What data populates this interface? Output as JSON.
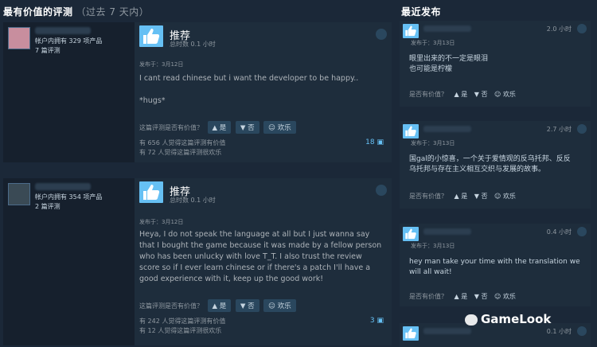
{
  "left_section": {
    "title": "最有价值的评测",
    "subtitle": "（过去 7 天内）"
  },
  "right_section": {
    "title": "最近发布"
  },
  "reviews": [
    {
      "owned": "帐户内拥有 329 项产品",
      "reviews_count": "7 篇评测",
      "verdict": "推荐",
      "hours": "总时数 0.1 小时",
      "posted": "发布于：3月12日",
      "text_lines": [
        "I cant read chinese but i want the developer to be happy..",
        "",
        "*hugs*"
      ],
      "helpful_q": "这篇评测是否有价值？",
      "yes": "是",
      "no": "否",
      "funny": "欢乐",
      "helpful_line": "有 656 人觉得这篇评测有价值",
      "funny_line": "有 72 人觉得这篇评测很欢乐",
      "comments": "18"
    },
    {
      "owned": "帐户内拥有 354 项产品",
      "reviews_count": "2 篇评测",
      "verdict": "推荐",
      "hours": "总时数 0.1 小时",
      "posted": "发布于：3月12日",
      "text_lines": [
        "Heya, I do not speak the language at all but I just wanna say",
        "that I bought the game because it was made by a fellow person",
        "who has been unlucky with love T_T. I also trust the review",
        "score so if I ever learn chinese or if there's a patch I'll have a",
        "good experience with it, keep up the good work!"
      ],
      "helpful_q": "这篇评测是否有价值？",
      "yes": "是",
      "no": "否",
      "funny": "欢乐",
      "helpful_line": "有 242 人觉得这篇评测有价值",
      "funny_line": "有 12 人觉得这篇评测很欢乐",
      "comments": "3"
    }
  ],
  "recent": [
    {
      "hours": "2.0 小时",
      "posted": "发布于：3月13日",
      "text_lines": [
        "眼里出来的不一定是眼泪",
        "也可能是柠檬"
      ],
      "helpful_q": "是否有价值？",
      "yes": "是",
      "no": "否",
      "funny": "欢乐"
    },
    {
      "hours": "2.7 小时",
      "posted": "发布于：3月13日",
      "text_lines": [
        "国gal的小惊喜，一个关于爱情观的反乌托邦、反反",
        "乌托邦与存在主义相互交织与发展的故事。"
      ],
      "helpful_q": "是否有价值？",
      "yes": "是",
      "no": "否",
      "funny": "欢乐"
    },
    {
      "hours": "0.4 小时",
      "posted": "发布于：3月13日",
      "text_lines": [
        "hey man take your time with the translation we",
        "will all wait!"
      ],
      "helpful_q": "是否有价值？",
      "yes": "是",
      "no": "否",
      "funny": "欢乐"
    },
    {
      "hours": "0.1 小时"
    }
  ],
  "watermark": "GameLook"
}
